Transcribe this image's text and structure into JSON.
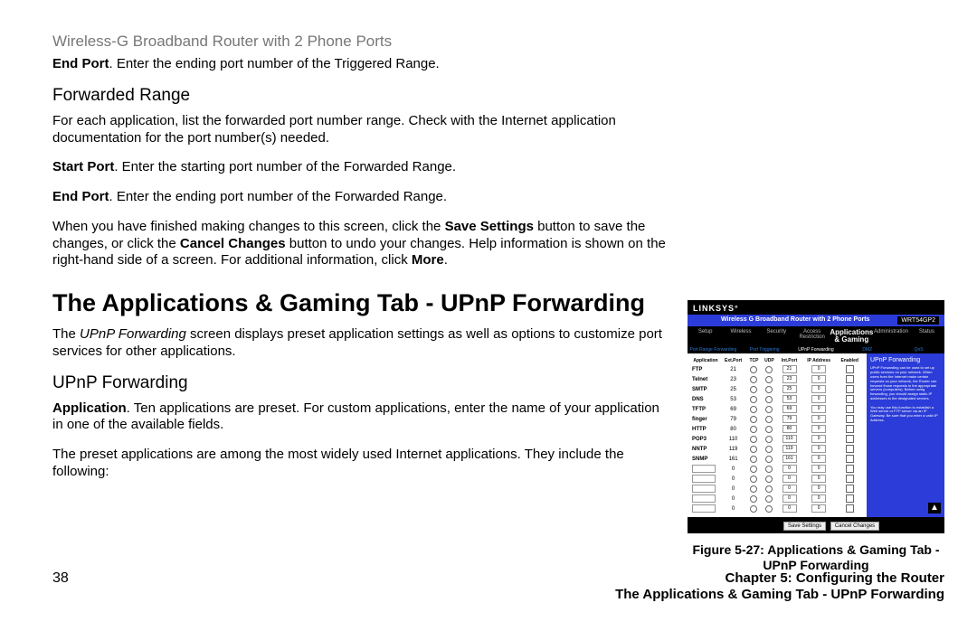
{
  "product_line": "Wireless-G Broadband Router with 2 Phone Ports",
  "p_endport_triggered": {
    "bold": "End Port",
    "rest": ". Enter the ending port number of the Triggered Range."
  },
  "h_forwarded": "Forwarded Range",
  "p_forwarded_intro": "For each application, list the forwarded port number range. Check with the Internet application documentation for the port number(s) needed.",
  "p_startport_forwarded": {
    "bold": "Start Port",
    "rest": ". Enter the starting port number of the Forwarded Range."
  },
  "p_endport_forwarded": {
    "bold": "End Port",
    "rest": ". Enter the ending port number of the Forwarded Range."
  },
  "p_save_changes": {
    "pre": "When you have finished making changes to this screen, click the ",
    "b1": "Save Settings",
    "mid1": " button to save the changes, or click the ",
    "b2": "Cancel Changes",
    "mid2": " button to undo your changes. Help information is shown on the right-hand side of a screen. For additional information, click ",
    "b3": "More",
    "post": "."
  },
  "h_main": "The Applications & Gaming Tab - UPnP Forwarding",
  "p_upnp_intro": {
    "pre": "The ",
    "italic": "UPnP Forwarding",
    "post": " screen displays preset application settings as well as options to customize port services for other applications."
  },
  "h_upnp": "UPnP Forwarding",
  "p_application": {
    "bold": "Application",
    "rest": ". Ten applications are preset. For custom applications, enter the name of your application in one of the available fields."
  },
  "p_preset_intro": "The preset applications are among the most widely used Internet applications. They include the following:",
  "figure": {
    "brand": "LINKSYS",
    "titlebar_text": "Wireless G Broadband Router with 2 Phone Ports",
    "model": "WRT54GP2",
    "active_tab_line1": "Applications",
    "active_tab_line2": "& Gaming",
    "tabs": [
      "Setup",
      "Wireless",
      "Security",
      "Access Restriction",
      "",
      "Administration",
      "Status"
    ],
    "subtabs": [
      "Port Range Forwarding",
      "Port Triggering",
      "UPnP Forwarding",
      "DMZ",
      "QoS"
    ],
    "col_headers": [
      "Application",
      "Ext.Port",
      "TCP",
      "UDP",
      "Int.Port",
      "IP Address",
      "Enabled"
    ],
    "rows": [
      {
        "app": "FTP",
        "ext": "21",
        "int": "21",
        "ip": "0"
      },
      {
        "app": "Telnet",
        "ext": "23",
        "int": "23",
        "ip": "0"
      },
      {
        "app": "SMTP",
        "ext": "25",
        "int": "25",
        "ip": "0"
      },
      {
        "app": "DNS",
        "ext": "53",
        "int": "53",
        "ip": "0"
      },
      {
        "app": "TFTP",
        "ext": "69",
        "int": "69",
        "ip": "0"
      },
      {
        "app": "finger",
        "ext": "79",
        "int": "79",
        "ip": "0"
      },
      {
        "app": "HTTP",
        "ext": "80",
        "int": "80",
        "ip": "0"
      },
      {
        "app": "POP3",
        "ext": "110",
        "int": "110",
        "ip": "0"
      },
      {
        "app": "NNTP",
        "ext": "119",
        "int": "119",
        "ip": "0"
      },
      {
        "app": "SNMP",
        "ext": "161",
        "int": "161",
        "ip": "0"
      },
      {
        "app": "",
        "ext": "0",
        "int": "0",
        "ip": "0"
      },
      {
        "app": "",
        "ext": "0",
        "int": "0",
        "ip": "0"
      },
      {
        "app": "",
        "ext": "0",
        "int": "0",
        "ip": "0"
      },
      {
        "app": "",
        "ext": "0",
        "int": "0",
        "ip": "0"
      },
      {
        "app": "",
        "ext": "0",
        "int": "0",
        "ip": "0"
      }
    ],
    "right_title": "UPnP Forwarding",
    "btn_save": "Save Settings",
    "btn_cancel": "Cancel Changes",
    "caption_line1": "Figure 5-27: Applications & Gaming Tab -",
    "caption_line2": "UPnP Forwarding"
  },
  "footer": {
    "page_num": "38",
    "right_line1": "Chapter 5: Configuring the Router",
    "right_line2": "The Applications & Gaming Tab - UPnP Forwarding"
  }
}
